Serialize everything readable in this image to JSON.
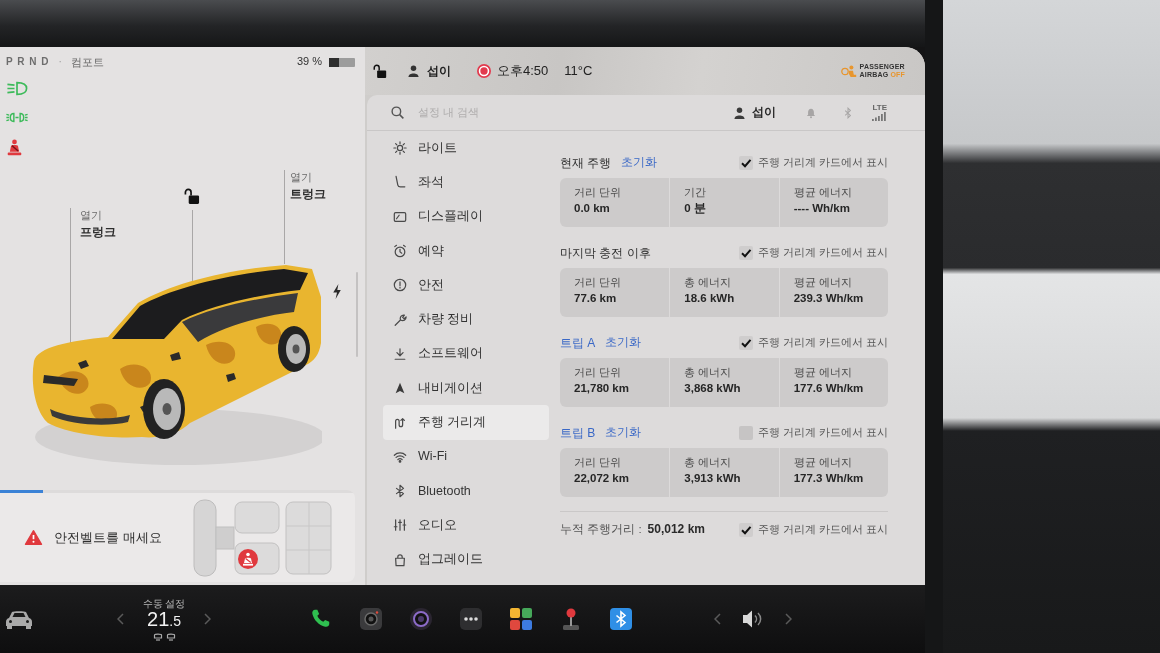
{
  "left_panel": {
    "gear": "P R N D",
    "separator": "·",
    "drive_mode": "컴포트",
    "battery": {
      "reading": "39 %",
      "level": 0.39
    },
    "indicators": [
      {
        "kind": "headlight",
        "color": "#3cba5a"
      },
      {
        "kind": "parking_light",
        "color": "#3cba5a"
      },
      {
        "kind": "seatbelt",
        "color": "#e0393e"
      }
    ],
    "trunk": {
      "action": "열기",
      "label": "트렁크"
    },
    "frunk": {
      "action": "열기",
      "label": "프렁크"
    },
    "car_locked": false,
    "alert": {
      "level": 0.12,
      "message": "안전벨트를 매세요"
    }
  },
  "status_bar": {
    "locked": false,
    "profile": "섭이",
    "recording": true,
    "time": "오후4:50",
    "temperature": "11°C",
    "airbag": {
      "line_1": "PASSENGER",
      "line_2": "AIRBAG",
      "state": "OFF"
    }
  },
  "settings": {
    "search": {
      "placeholder": "설정 내 검색"
    },
    "profile": "섭이",
    "network": "LTE",
    "menu": [
      {
        "label": "라이트",
        "selected": false
      },
      {
        "label": "좌석",
        "selected": false
      },
      {
        "label": "디스플레이",
        "selected": false
      },
      {
        "label": "예약",
        "selected": false
      },
      {
        "label": "안전",
        "selected": false
      },
      {
        "label": "차량 정비",
        "selected": false
      },
      {
        "label": "소프트웨어",
        "selected": false
      },
      {
        "label": "내비게이션",
        "selected": false
      },
      {
        "label": "주행 거리계",
        "selected": true
      },
      {
        "label": "Wi-Fi",
        "selected": false
      },
      {
        "label": "Bluetooth",
        "selected": false
      },
      {
        "label": "오디오",
        "selected": false
      },
      {
        "label": "업그레이드",
        "selected": false
      }
    ],
    "sections": [
      {
        "title": "현재 주행",
        "title_link": false,
        "reset": "초기화",
        "show_on_card": {
          "label": "주행 거리계 카드에서 표시",
          "checked": true
        },
        "stats": [
          {
            "label": "거리 단위",
            "value": "0.0 km"
          },
          {
            "label": "기간",
            "value": "0 분"
          },
          {
            "label": "평균 에너지",
            "value": "---- Wh/km"
          }
        ]
      },
      {
        "title": "마지막 충전 이후",
        "title_link": false,
        "show_on_card": {
          "label": "주행 거리계 카드에서 표시",
          "checked": true
        },
        "stats": [
          {
            "label": "거리 단위",
            "value": "77.6 km"
          },
          {
            "label": "총 에너지",
            "value": "18.6 kWh"
          },
          {
            "label": "평균 에너지",
            "value": "239.3 Wh/km"
          }
        ]
      },
      {
        "title": "트립 A",
        "title_link": true,
        "reset": "초기화",
        "show_on_card": {
          "label": "주행 거리계 카드에서 표시",
          "checked": true
        },
        "stats": [
          {
            "label": "거리 단위",
            "value": "21,780 km"
          },
          {
            "label": "총 에너지",
            "value": "3,868 kWh"
          },
          {
            "label": "평균 에너지",
            "value": "177.6 Wh/km"
          }
        ]
      },
      {
        "title": "트립 B",
        "title_link": true,
        "reset": "초기화",
        "show_on_card": {
          "label": "주행 거리계 카드에서 표시",
          "checked": false
        },
        "stats": [
          {
            "label": "거리 단위",
            "value": "22,072 km"
          },
          {
            "label": "총 에너지",
            "value": "3,913 kWh"
          },
          {
            "label": "평균 에너지",
            "value": "177.3 Wh/km"
          }
        ]
      }
    ],
    "odometer": {
      "label": "누적 주행거리 :",
      "value": "50,012 km",
      "show_on_card": {
        "label": "주행 거리계 카드에서 표시",
        "checked": true
      }
    }
  },
  "dock": {
    "climate": {
      "mode": "수동 설정",
      "temperature": "21.5"
    }
  }
}
